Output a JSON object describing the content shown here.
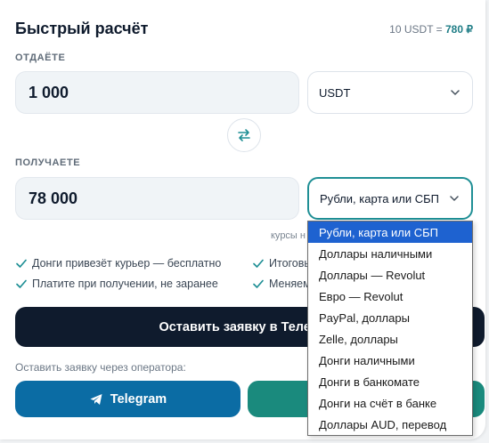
{
  "header": {
    "title": "Быстрый расчёт",
    "rate_prefix": "10 USDT =",
    "rate_value": "780 ₽"
  },
  "give": {
    "label": "ОТДАЁТЕ",
    "amount": "1 000",
    "currency": "USDT"
  },
  "receive": {
    "label": "ПОЛУЧАЕТЕ",
    "amount": "78 000",
    "method": "Рубли, карта или СБП"
  },
  "rates_hint": "курсы н",
  "features": [
    "Донги привезёт курьер — бесплатно",
    "Итоговы",
    "Платите при получении, не заранее",
    "Меняем"
  ],
  "cta": {
    "label": "Оставить заявку в Телеграм"
  },
  "operator": {
    "label": "Оставить заявку через оператора:",
    "telegram": "Telegram"
  },
  "dropdown": {
    "options": [
      "Рубли, карта или СБП",
      "Доллары наличными",
      "Доллары — Revolut",
      "Евро — Revolut",
      "PayPal, доллары",
      "Zelle, доллары",
      "Донги наличными",
      "Донги в банкомате",
      "Донги на счёт в банке",
      "Доллары AUD, перевод"
    ],
    "selected_index": 0
  },
  "icons": {
    "chevron": "chevron-down-icon",
    "swap": "swap-arrows-icon",
    "check": "check-icon",
    "telegram": "telegram-plane-icon"
  },
  "colors": {
    "accent": "#1f8f95",
    "primary_dark": "#0f1b2d",
    "telegram_blue": "#0b6ca4",
    "green": "#1a8a7d",
    "dropdown_selected": "#1e62d0"
  }
}
